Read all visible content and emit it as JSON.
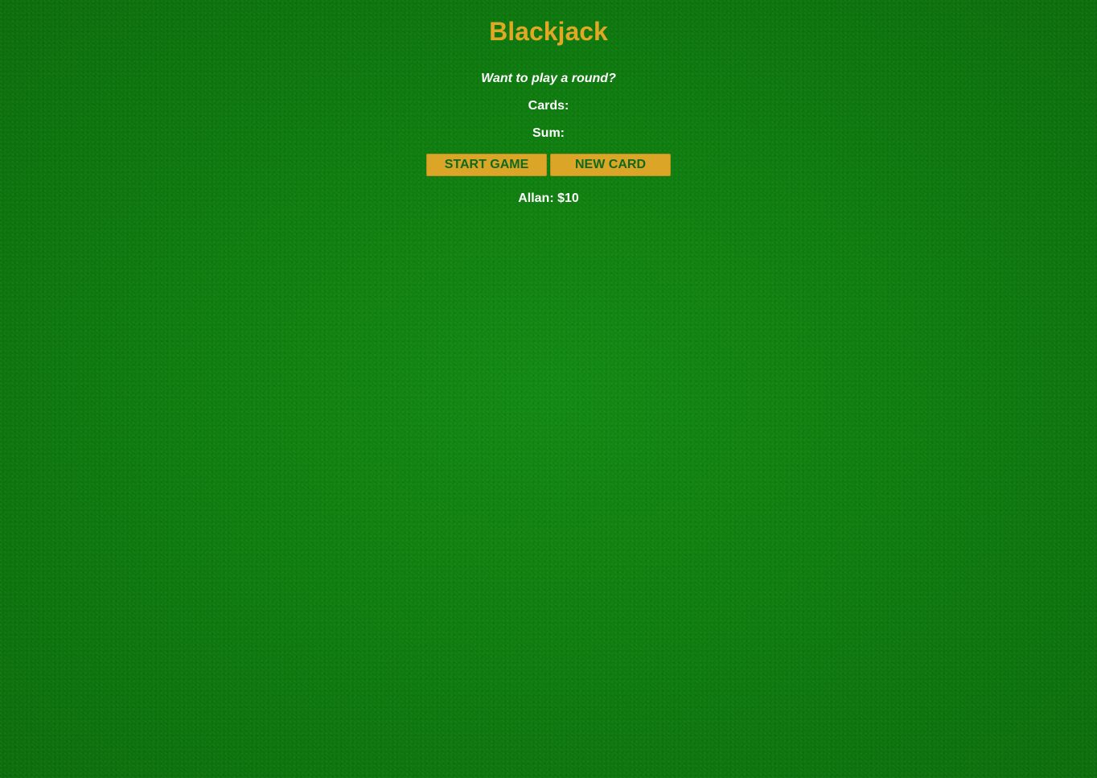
{
  "title": "Blackjack",
  "message": "Want to play a round?",
  "cards_label": "Cards:",
  "sum_label": "Sum:",
  "buttons": {
    "start": "START GAME",
    "new_card": "NEW CARD"
  },
  "player": "Allan: $10",
  "colors": {
    "background": "#10800f",
    "title": "#e0a825",
    "button_bg": "#dba527",
    "button_text": "#0f6a1d",
    "text": "#ffffff"
  }
}
